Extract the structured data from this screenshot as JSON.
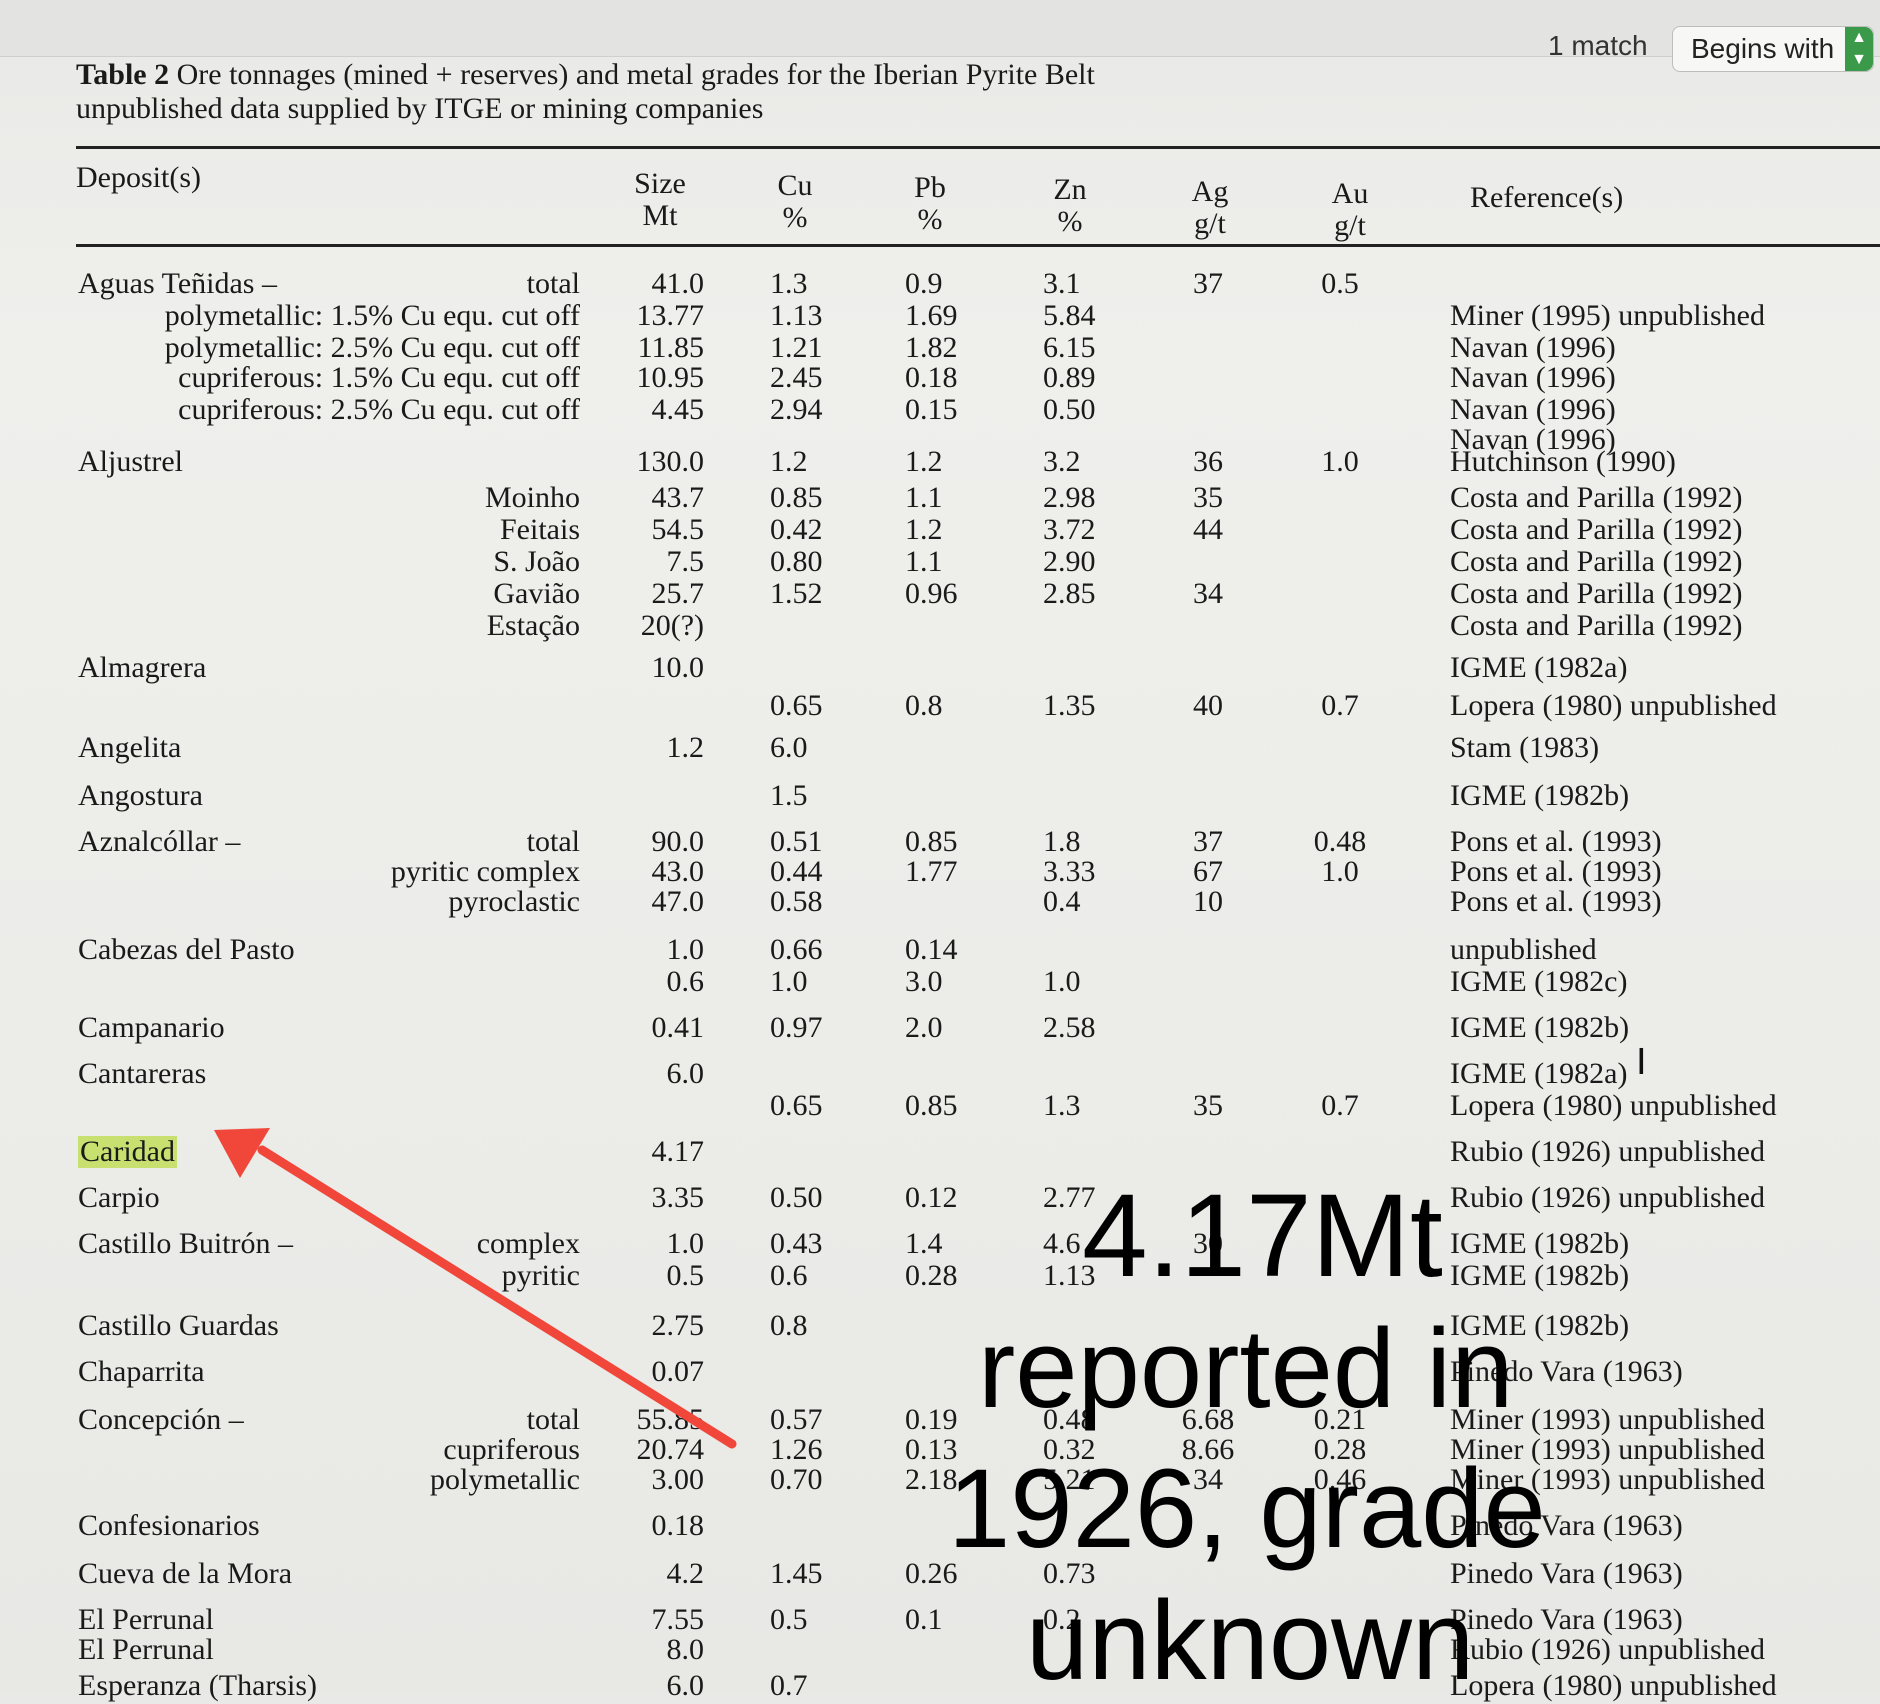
{
  "find_bar": {
    "match_count": "1 match",
    "mode": "Begins with"
  },
  "caption": {
    "label": "Table 2",
    "text": " Ore tonnages (mined + reserves) and metal grades for the Iberian Pyrite Belt",
    "line2": "unpublished data supplied by ITGE or mining companies"
  },
  "headers": {
    "deposit": "Deposit(s)",
    "size": [
      "Size",
      "Mt"
    ],
    "cu": [
      "Cu",
      "%"
    ],
    "pb": [
      "Pb",
      "%"
    ],
    "zn": [
      "Zn",
      "%"
    ],
    "ag": [
      "Ag",
      "g/t"
    ],
    "au": [
      "Au",
      "g/t"
    ],
    "reference": "Reference(s)"
  },
  "rows": [
    {
      "name": "Aguas Teñidas –",
      "sub": "total",
      "size": "41.0",
      "cu": "1.3",
      "pb": "0.9",
      "zn": "3.1",
      "ag": "37",
      "au": "0.5",
      "ref": ""
    },
    {
      "name": "",
      "sub": "polymetallic: 1.5% Cu equ. cut off",
      "size": "13.77",
      "cu": "1.13",
      "pb": "1.69",
      "zn": "5.84",
      "ag": "",
      "au": "",
      "ref": "Miner (1995) unpublished"
    },
    {
      "name": "",
      "sub": "polymetallic: 2.5% Cu equ. cut off",
      "size": "11.85",
      "cu": "1.21",
      "pb": "1.82",
      "zn": "6.15",
      "ag": "",
      "au": "",
      "ref": "Navan (1996)"
    },
    {
      "name": "",
      "sub": "cupriferous: 1.5% Cu equ. cut off",
      "size": "10.95",
      "cu": "2.45",
      "pb": "0.18",
      "zn": "0.89",
      "ag": "",
      "au": "",
      "ref": "Navan (1996)"
    },
    {
      "name": "",
      "sub": "cupriferous: 2.5% Cu equ. cut off",
      "size": "4.45",
      "cu": "2.94",
      "pb": "0.15",
      "zn": "0.50",
      "ag": "",
      "au": "",
      "ref": "Navan (1996)"
    },
    {
      "name": "",
      "sub": "",
      "size": "",
      "cu": "",
      "pb": "",
      "zn": "",
      "ag": "",
      "au": "",
      "ref": "Navan (1996)"
    },
    {
      "name": "Aljustrel",
      "sub": "",
      "size": "130.0",
      "cu": "1.2",
      "pb": "1.2",
      "zn": "3.2",
      "ag": "36",
      "au": "1.0",
      "ref": "Hutchinson (1990)"
    },
    {
      "name": "",
      "sub": "Moinho",
      "size": "43.7",
      "cu": "0.85",
      "pb": "1.1",
      "zn": "2.98",
      "ag": "35",
      "au": "",
      "ref": "Costa and Parilla (1992)"
    },
    {
      "name": "",
      "sub": "Feitais",
      "size": "54.5",
      "cu": "0.42",
      "pb": "1.2",
      "zn": "3.72",
      "ag": "44",
      "au": "",
      "ref": "Costa and Parilla (1992)"
    },
    {
      "name": "",
      "sub": "S. João",
      "size": "7.5",
      "cu": "0.80",
      "pb": "1.1",
      "zn": "2.90",
      "ag": "",
      "au": "",
      "ref": "Costa and Parilla (1992)"
    },
    {
      "name": "",
      "sub": "Gavião",
      "size": "25.7",
      "cu": "1.52",
      "pb": "0.96",
      "zn": "2.85",
      "ag": "34",
      "au": "",
      "ref": "Costa and Parilla (1992)"
    },
    {
      "name": "",
      "sub": "Estação",
      "size": "20(?)",
      "cu": "",
      "pb": "",
      "zn": "",
      "ag": "",
      "au": "",
      "ref": "Costa and Parilla (1992)"
    },
    {
      "name": "Almagrera",
      "sub": "",
      "size": "10.0",
      "cu": "",
      "pb": "",
      "zn": "",
      "ag": "",
      "au": "",
      "ref": "IGME (1982a)"
    },
    {
      "name": "",
      "sub": "",
      "size": "",
      "cu": "0.65",
      "pb": "0.8",
      "zn": "1.35",
      "ag": "40",
      "au": "0.7",
      "ref": "Lopera (1980) unpublished"
    },
    {
      "name": "Angelita",
      "sub": "",
      "size": "1.2",
      "cu": "6.0",
      "pb": "",
      "zn": "",
      "ag": "",
      "au": "",
      "ref": "Stam (1983)"
    },
    {
      "name": "Angostura",
      "sub": "",
      "size": "",
      "cu": "1.5",
      "pb": "",
      "zn": "",
      "ag": "",
      "au": "",
      "ref": "IGME (1982b)"
    },
    {
      "name": "Aznalcóllar –",
      "sub": "total",
      "size": "90.0",
      "cu": "0.51",
      "pb": "0.85",
      "zn": "1.8",
      "ag": "37",
      "au": "0.48",
      "ref": "Pons et al. (1993)"
    },
    {
      "name": "",
      "sub": "pyritic complex",
      "size": "43.0",
      "cu": "0.44",
      "pb": "1.77",
      "zn": "3.33",
      "ag": "67",
      "au": "1.0",
      "ref": "Pons et al. (1993)"
    },
    {
      "name": "",
      "sub": "pyroclastic",
      "size": "47.0",
      "cu": "0.58",
      "pb": "",
      "zn": "0.4",
      "ag": "10",
      "au": "",
      "ref": "Pons et al. (1993)"
    },
    {
      "name": "Cabezas del Pasto",
      "sub": "",
      "size": "1.0",
      "cu": "0.66",
      "pb": "0.14",
      "zn": "",
      "ag": "",
      "au": "",
      "ref": "unpublished"
    },
    {
      "name": "",
      "sub": "",
      "size": "0.6",
      "cu": "1.0",
      "pb": "3.0",
      "zn": "1.0",
      "ag": "",
      "au": "",
      "ref": "IGME (1982c)"
    },
    {
      "name": "Campanario",
      "sub": "",
      "size": "0.41",
      "cu": "0.97",
      "pb": "2.0",
      "zn": "2.58",
      "ag": "",
      "au": "",
      "ref": "IGME (1982b)"
    },
    {
      "name": "Cantareras",
      "sub": "",
      "size": "6.0",
      "cu": "",
      "pb": "",
      "zn": "",
      "ag": "",
      "au": "",
      "ref": "IGME (1982a)"
    },
    {
      "name": "",
      "sub": "",
      "size": "",
      "cu": "0.65",
      "pb": "0.85",
      "zn": "1.3",
      "ag": "35",
      "au": "0.7",
      "ref": "Lopera (1980) unpublished"
    },
    {
      "name": "Caridad",
      "sub": "",
      "size": "4.17",
      "cu": "",
      "pb": "",
      "zn": "",
      "ag": "",
      "au": "",
      "ref": "Rubio (1926) unpublished",
      "highlight": true
    },
    {
      "name": "Carpio",
      "sub": "",
      "size": "3.35",
      "cu": "0.50",
      "pb": "0.12",
      "zn": "2.77",
      "ag": "",
      "au": "",
      "ref": "Rubio (1926) unpublished"
    },
    {
      "name": "Castillo Buitrón –",
      "sub": "complex",
      "size": "1.0",
      "cu": "0.43",
      "pb": "1.4",
      "zn": "4.6",
      "ag": "30",
      "au": "",
      "ref": "IGME (1982b)"
    },
    {
      "name": "",
      "sub": "pyritic",
      "size": "0.5",
      "cu": "0.6",
      "pb": "0.28",
      "zn": "1.13",
      "ag": "",
      "au": "",
      "ref": "IGME (1982b)"
    },
    {
      "name": "Castillo Guardas",
      "sub": "",
      "size": "2.75",
      "cu": "0.8",
      "pb": "",
      "zn": "",
      "ag": "",
      "au": "",
      "ref": "IGME (1982b)"
    },
    {
      "name": "Chaparrita",
      "sub": "",
      "size": "0.07",
      "cu": "",
      "pb": "",
      "zn": "",
      "ag": "",
      "au": "",
      "ref": "Pinedo Vara (1963)"
    },
    {
      "name": "Concepción –",
      "sub": "total",
      "size": "55.85",
      "cu": "0.57",
      "pb": "0.19",
      "zn": "0.48",
      "ag": "6.68",
      "au": "0.21",
      "ref": "Miner (1993) unpublished"
    },
    {
      "name": "",
      "sub": "cupriferous",
      "size": "20.74",
      "cu": "1.26",
      "pb": "0.13",
      "zn": "0.32",
      "ag": "8.66",
      "au": "0.28",
      "ref": "Miner (1993) unpublished"
    },
    {
      "name": "",
      "sub": "polymetallic",
      "size": "3.00",
      "cu": "0.70",
      "pb": "2.18",
      "zn": "5.21",
      "ag": "34",
      "au": "0.46",
      "ref": "Miner (1993) unpublished"
    },
    {
      "name": "Confesionarios",
      "sub": "",
      "size": "0.18",
      "cu": "",
      "pb": "",
      "zn": "",
      "ag": "",
      "au": "",
      "ref": "Pinedo Vara (1963)"
    },
    {
      "name": "Cueva de la Mora",
      "sub": "",
      "size": "4.2",
      "cu": "1.45",
      "pb": "0.26",
      "zn": "0.73",
      "ag": "",
      "au": "",
      "ref": "Pinedo Vara (1963)"
    },
    {
      "name": "El Perrunal",
      "sub": "",
      "size": "7.55",
      "cu": "0.5",
      "pb": "0.1",
      "zn": "0.2",
      "ag": "",
      "au": "",
      "ref": "Pinedo Vara (1963)"
    },
    {
      "name": "El Perrunal",
      "sub": "",
      "size": "8.0",
      "cu": "",
      "pb": "",
      "zn": "",
      "ag": "",
      "au": "",
      "ref": "Rubio (1926) unpublished"
    },
    {
      "name": "Esperanza (Tharsis)",
      "sub": "",
      "size": "6.0",
      "cu": "0.7",
      "pb": "",
      "zn": "",
      "ag": "",
      "au": "",
      "ref": "Lopera (1980) unpublished"
    }
  ],
  "annotation": {
    "line1": "4.17Mt",
    "line2": "reported in",
    "line3": "1926, grade",
    "line4": "unknown",
    "arrow_color": "#f0473a"
  }
}
